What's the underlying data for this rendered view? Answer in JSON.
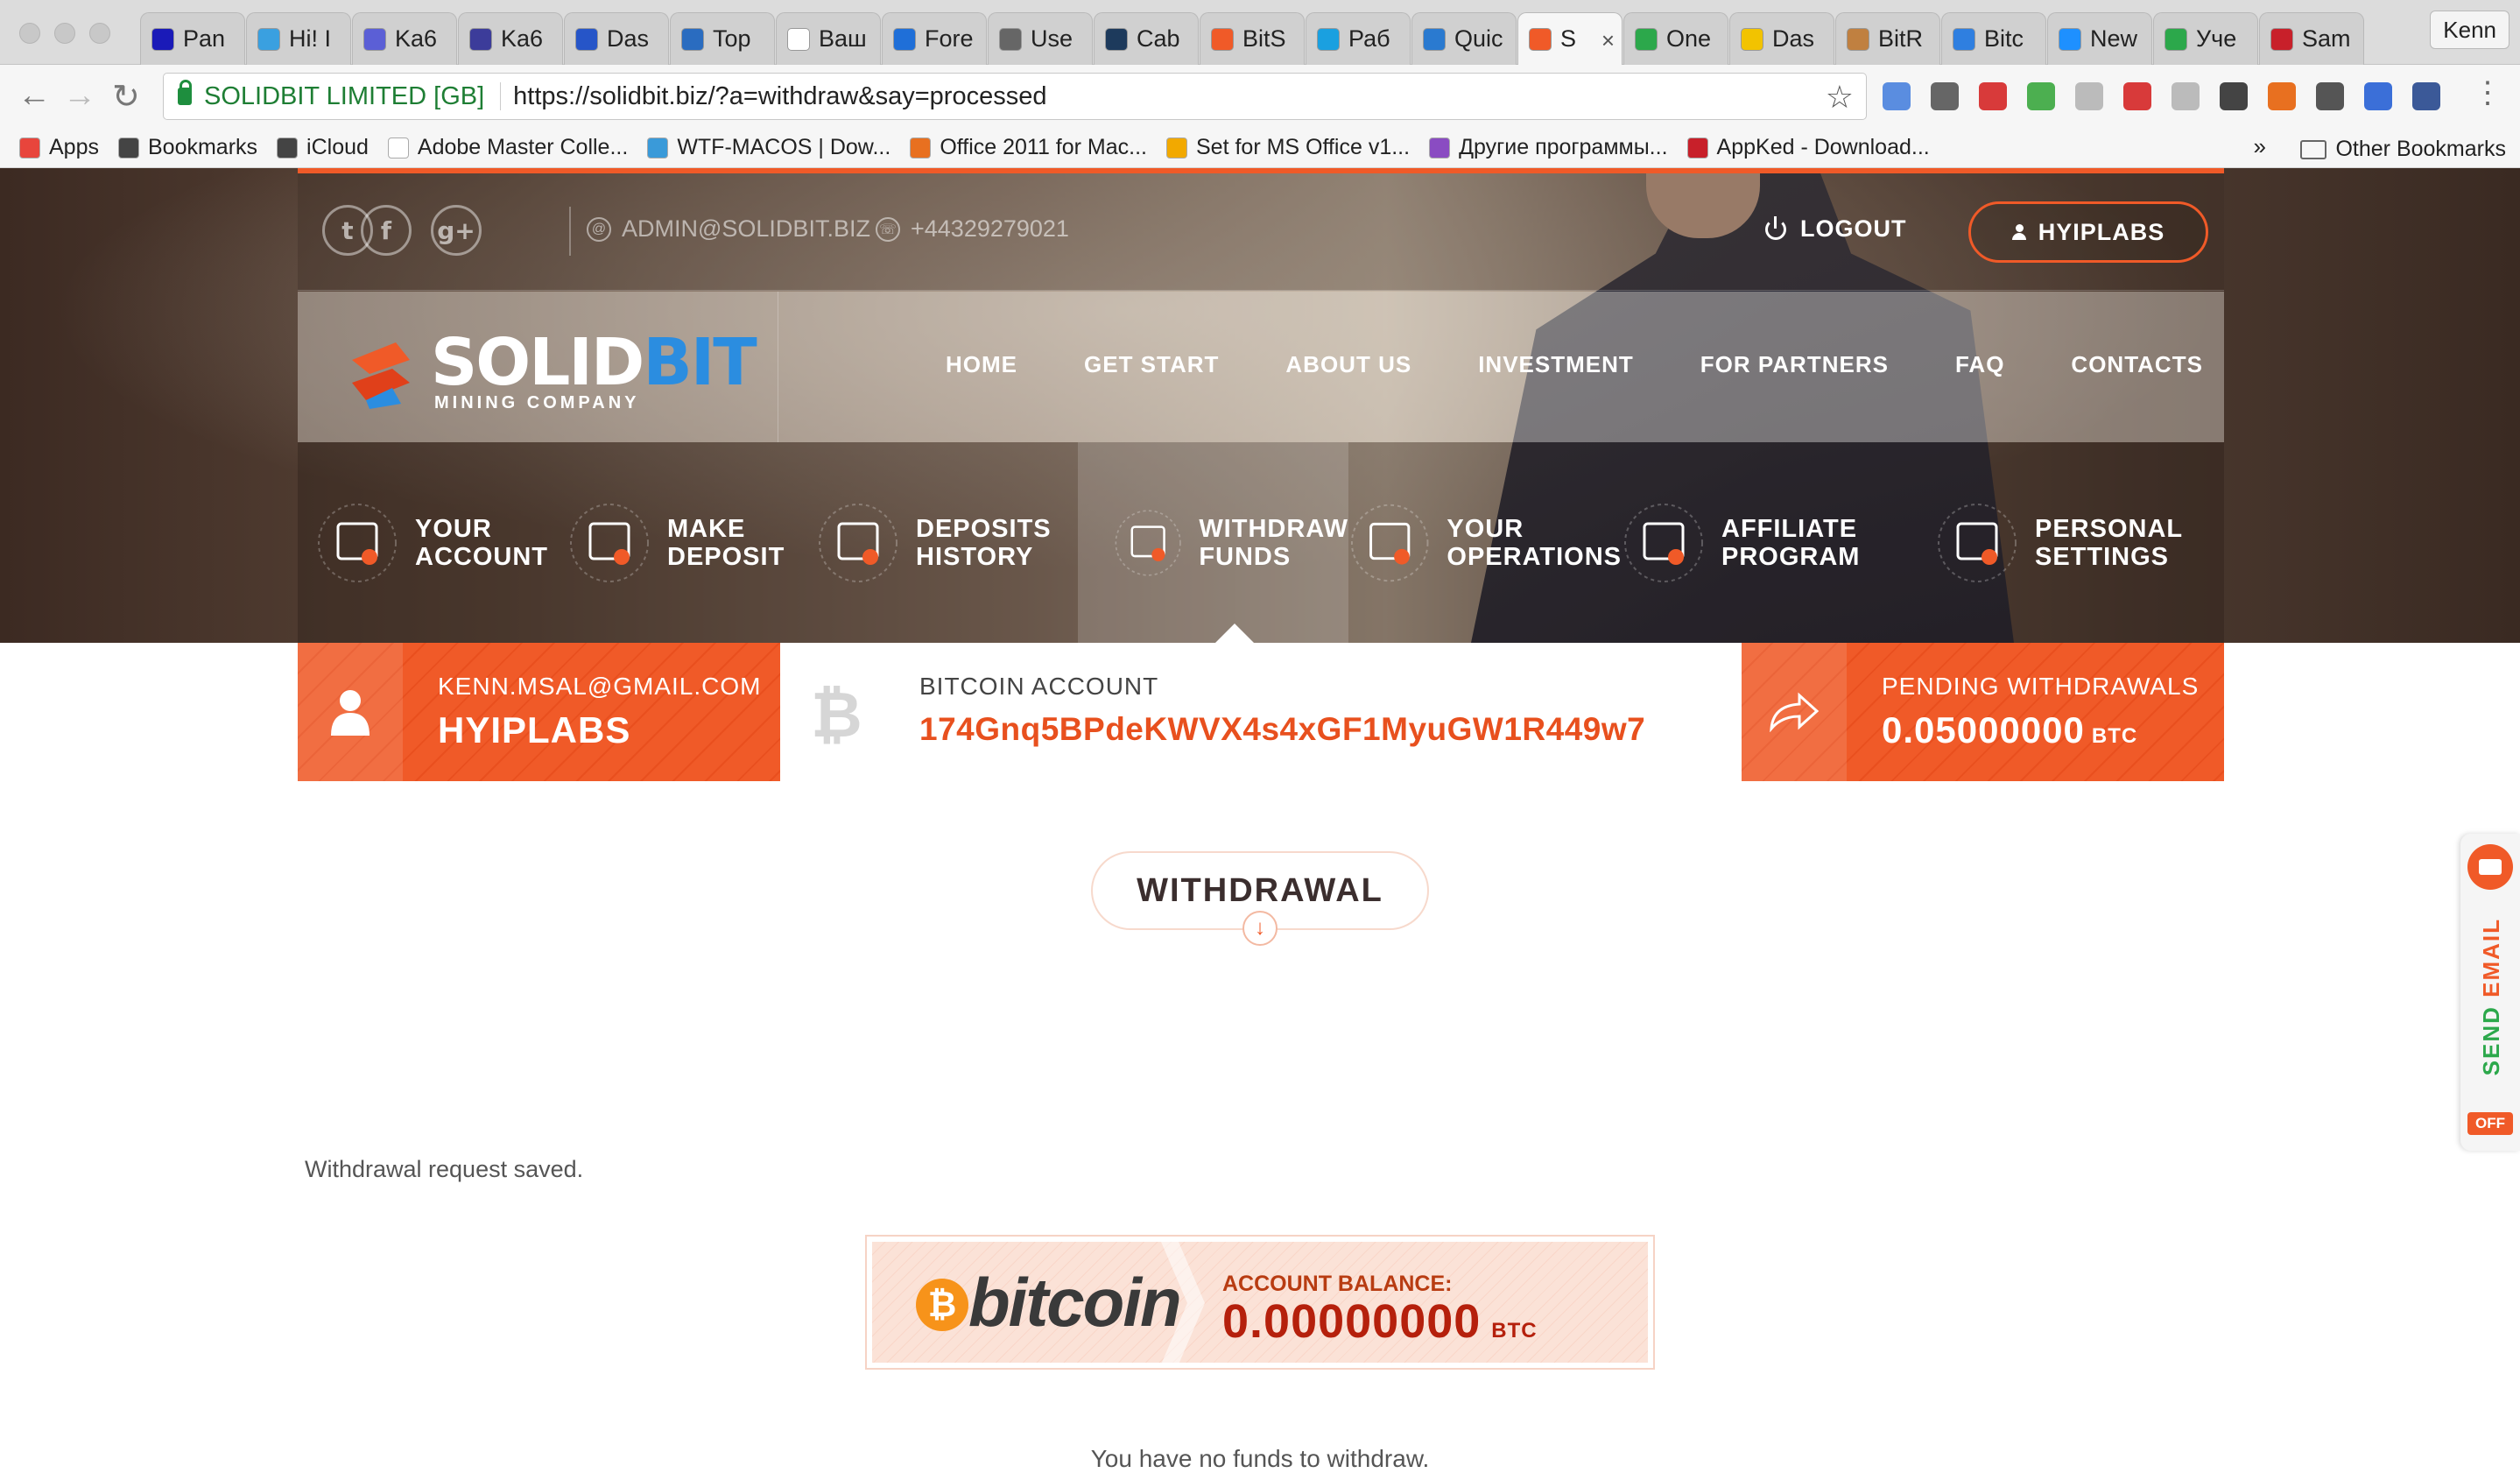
{
  "browser": {
    "tabs": [
      {
        "label": "Pan",
        "icon": "pantheon-icon",
        "color": "#1a1ab8"
      },
      {
        "label": "Hi! I",
        "icon": "hexagon-icon",
        "color": "#3aa0e0"
      },
      {
        "label": "Ka6",
        "icon": "hs-icon",
        "color": "#5b5fd6"
      },
      {
        "label": "Ka6",
        "icon": "bp-icon",
        "color": "#3c3c9a"
      },
      {
        "label": "Das",
        "icon": "x-icon",
        "color": "#2655c8"
      },
      {
        "label": "Top",
        "icon": "globe-icon",
        "color": "#2a6cc0"
      },
      {
        "label": "Ваш",
        "icon": "page-icon",
        "color": "#ffffff"
      },
      {
        "label": "Fore",
        "icon": "star-icon",
        "color": "#1f6fd8"
      },
      {
        "label": "Use",
        "icon": "link-icon",
        "color": "#666666"
      },
      {
        "label": "Cab",
        "icon": "coin-icon",
        "color": "#1d3a5c"
      },
      {
        "label": "BitS",
        "icon": "hex-icon",
        "color": "#f05a28"
      },
      {
        "label": "Раб",
        "icon": "t-icon",
        "color": "#1aa0e0"
      },
      {
        "label": "Quic",
        "icon": "chart-icon",
        "color": "#2a7ad0"
      },
      {
        "label": "S",
        "icon": "solidbit-icon",
        "color": "#f05a28",
        "active": true
      },
      {
        "label": "One",
        "icon": "leaf-icon",
        "color": "#2ca84b"
      },
      {
        "label": "Das",
        "icon": "smile-icon",
        "color": "#f2c300"
      },
      {
        "label": "BitR",
        "icon": "bitr-icon",
        "color": "#c08040"
      },
      {
        "label": "Bitc",
        "icon": "b-icon",
        "color": "#2f7fe0"
      },
      {
        "label": "New",
        "icon": "s-icon",
        "color": "#1e90ff"
      },
      {
        "label": "Уче",
        "icon": "arrow-icon",
        "color": "#2ca84b"
      },
      {
        "label": "Sam",
        "icon": "ring-icon",
        "color": "#c8202a"
      }
    ],
    "profile_name": "Kenn",
    "cert_name": "SOLIDBIT LIMITED [GB]",
    "url": "https://solidbit.biz/?a=withdraw&say=processed",
    "bookmarks": [
      {
        "label": "Apps",
        "icon": "apps-grid-icon",
        "color": "#e8453c"
      },
      {
        "label": "Bookmarks",
        "icon": "star-icon",
        "color": "#444444"
      },
      {
        "label": "iCloud",
        "icon": "apple-icon",
        "color": "#444444"
      },
      {
        "label": "Adobe Master Colle...",
        "icon": "page-icon",
        "color": "#ffffff"
      },
      {
        "label": "WTF-MACOS | Dow...",
        "icon": "x-icon",
        "color": "#3a9ad9"
      },
      {
        "label": "Office 2011 for Mac...",
        "icon": "puzzle-icon",
        "color": "#e87020"
      },
      {
        "label": "Set for MS Office v1...",
        "icon": "windows-icon",
        "color": "#f2a900"
      },
      {
        "label": "Другие программы...",
        "icon": "programs-icon",
        "color": "#8a4cc2"
      },
      {
        "label": "AppKed - Download...",
        "icon": "appked-icon",
        "color": "#c8202a"
      }
    ],
    "more_label": "»",
    "other_bookmarks": "Other Bookmarks",
    "extensions": [
      "#5a8de0",
      "#666666",
      "#d83a3a",
      "#4caf50",
      "#bbbbbb",
      "#d83a3a",
      "#bbbbbb",
      "#444444",
      "#e87020",
      "#555555",
      "#3b6fd8",
      "#3b5998"
    ]
  },
  "site": {
    "email": "ADMIN@SOLIDBIT.BIZ",
    "phone": "+44329279021",
    "logout": "LOGOUT",
    "user_button": "HYIPLABS",
    "logo": {
      "part1": "SOLID",
      "part2": "BIT",
      "sub": "MINING COMPANY"
    },
    "nav": [
      "HOME",
      "GET START",
      "ABOUT US",
      "INVESTMENT",
      "FOR PARTNERS",
      "FAQ",
      "CONTACTS"
    ],
    "dashboard": [
      {
        "label": "YOUR\nACCOUNT",
        "icon": "account-icon"
      },
      {
        "label": "MAKE\nDEPOSIT",
        "icon": "deposit-icon"
      },
      {
        "label": "DEPOSITS\nHISTORY",
        "icon": "calendar-icon"
      },
      {
        "label": "WITHDRAW\nFUNDS",
        "icon": "withdraw-icon",
        "active": true
      },
      {
        "label": "YOUR\nOPERATIONS",
        "icon": "operations-icon"
      },
      {
        "label": "AFFILIATE\nPROGRAM",
        "icon": "affiliate-icon"
      },
      {
        "label": "PERSONAL\nSETTINGS",
        "icon": "settings-icon"
      }
    ],
    "account": {
      "email": "KENN.MSAL@GMAIL.COM",
      "username": "HYIPLABS",
      "btc_label": "BITCOIN ACCOUNT",
      "btc_address": "174Gnq5BPdeKWVX4s4xGF1MyuGW1R449w7",
      "pending_label": "PENDING WITHDRAWALS",
      "pending_value": "0.05000000",
      "pending_unit": "BTC"
    },
    "content": {
      "title": "WITHDRAWAL",
      "status": "Withdrawal request saved.",
      "bitcoin_word": "bitcoin",
      "balance_label": "ACCOUNT BALANCE:",
      "balance_value": "0.00000000",
      "balance_unit": "BTC",
      "no_funds": "You have no funds to withdraw."
    },
    "widget": {
      "label_main": "SEND ",
      "label_accent": "EMAIL",
      "off": "OFF"
    },
    "colors": {
      "accent": "#f05a28",
      "accent_dark": "#b5200c",
      "btc_orange": "#f7931a"
    }
  }
}
